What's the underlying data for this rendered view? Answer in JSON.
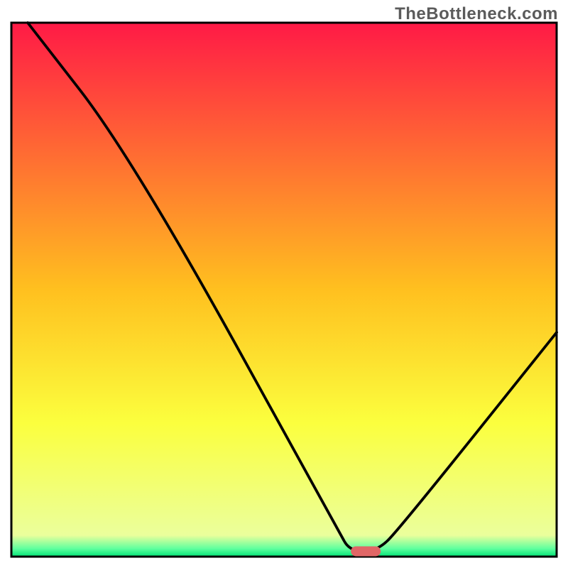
{
  "watermark": "TheBottleneck.com",
  "chart_data": {
    "type": "line",
    "title": "",
    "xlabel": "",
    "ylabel": "",
    "xlim": [
      0,
      100
    ],
    "ylim": [
      0,
      100
    ],
    "x": [
      3,
      22,
      60,
      62,
      67,
      71,
      100
    ],
    "values": [
      100,
      75,
      5,
      1,
      1,
      5,
      42
    ],
    "minimum_marker": {
      "x": 65,
      "y": 1
    },
    "gradient_stops": [
      {
        "offset": 0.0,
        "color": "#ff1a46"
      },
      {
        "offset": 0.5,
        "color": "#ffc01f"
      },
      {
        "offset": 0.75,
        "color": "#fbff3e"
      },
      {
        "offset": 0.96,
        "color": "#ebff9c"
      },
      {
        "offset": 0.985,
        "color": "#5fff9e"
      },
      {
        "offset": 1.0,
        "color": "#00e276"
      }
    ]
  }
}
